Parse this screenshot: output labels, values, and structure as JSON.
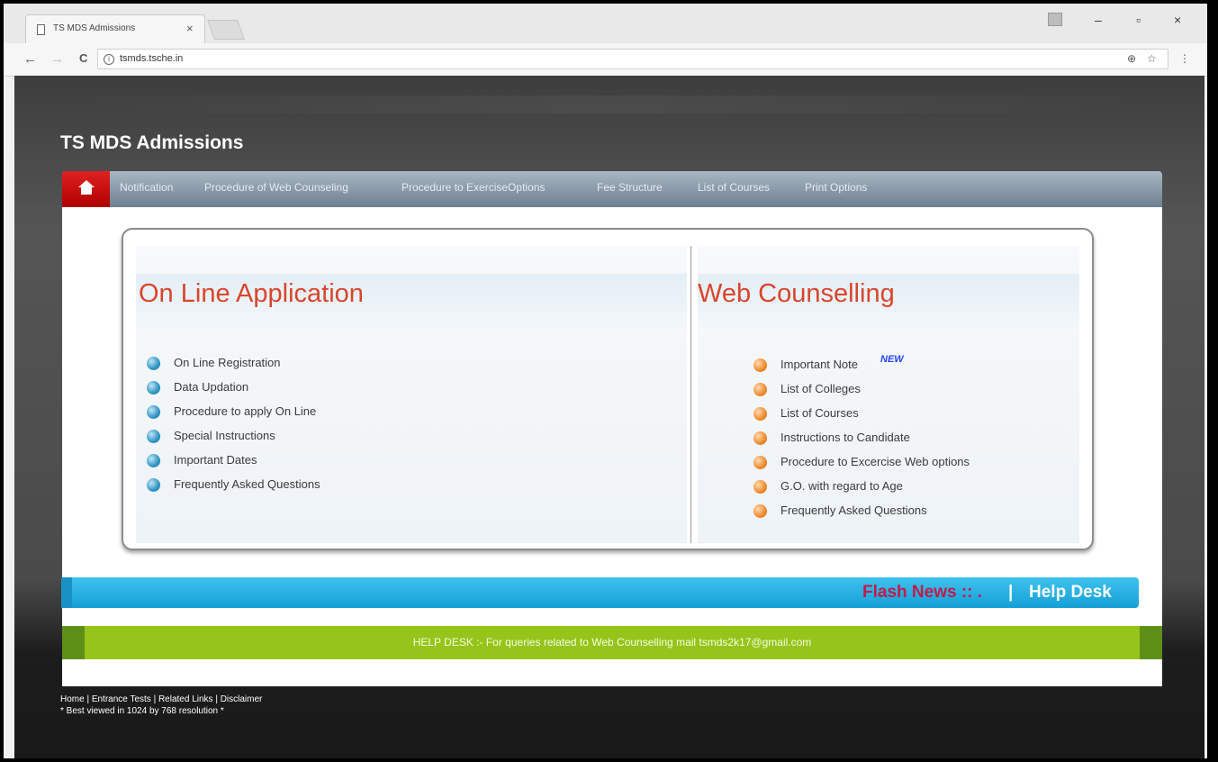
{
  "browser": {
    "tab_title": "TS MDS Admissions",
    "tab_close": "×",
    "url": "tsmds.tsche.in",
    "info_glyph": "i",
    "nav": {
      "back": "←",
      "forward": "→",
      "reload": "C"
    },
    "window": {
      "minimize": "–",
      "restore": "▫",
      "close": "×"
    },
    "toolbar_right": {
      "zoom": "⊕",
      "star": "☆",
      "menu": "⋮"
    }
  },
  "site": {
    "title": "TS MDS Admissions"
  },
  "navbar": {
    "items": [
      "Notification",
      "Procedure of Web Counseling",
      "Procedure to ExerciseOptions",
      "Fee Structure",
      "List of Courses",
      "Print Options"
    ]
  },
  "online_application": {
    "heading": "On Line Application",
    "links": [
      "On Line Registration",
      "Data Updation",
      "Procedure to apply On Line",
      "Special Instructions",
      "Important Dates",
      "Frequently Asked Questions"
    ]
  },
  "web_counselling": {
    "heading": "Web Counselling",
    "new_badge": "NEW",
    "links": [
      "Important Note",
      "List of Colleges",
      "List of Courses",
      "Instructions to Candidate",
      "Procedure to Excercise Web options",
      "G.O. with regard to Age",
      "Frequently Asked Questions"
    ]
  },
  "flash": {
    "news": "Flash News :: .",
    "separator": "|",
    "help_desk": "Help Desk"
  },
  "help_desk_bar": {
    "text": "HELP DESK :- For queries related to Web Counselling mail tsmds2k17@gmail.com"
  },
  "footer": {
    "links": "Home | Entrance Tests | Related Links | Disclaimer",
    "note": "* Best viewed in 1024 by 768 resolution *"
  },
  "colors": {
    "heading": "#d8452c",
    "nav_home": "#cc0000",
    "flash_bar": "#1aa8de",
    "help_bar": "#96c41a",
    "flash_news": "#c21a4a"
  }
}
